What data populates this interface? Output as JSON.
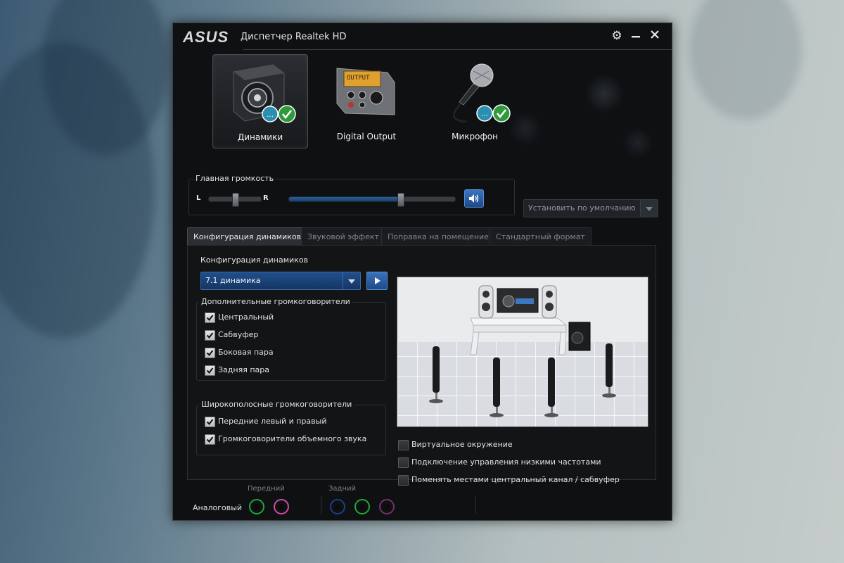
{
  "window": {
    "logo": "ASUS",
    "title": "Диспетчер Realtek HD"
  },
  "titlebar_icons": [
    "gear-icon",
    "minimize-icon",
    "close-icon"
  ],
  "devices": [
    {
      "label": "Динамики",
      "icon": "speaker-icon",
      "active": true,
      "badges": [
        "chat-badge-icon",
        "check-badge-icon"
      ]
    },
    {
      "label": "Digital Output",
      "icon": "digital-output-icon",
      "active": false
    },
    {
      "label": "Микрофон",
      "icon": "microphone-icon",
      "active": false,
      "badges": [
        "chat-badge-icon",
        "check-badge-icon"
      ]
    }
  ],
  "volume": {
    "title": "Главная громкость",
    "left_label": "L",
    "right_label": "R",
    "balance": 0.5,
    "level": 0.67
  },
  "default_button": {
    "label": "Установить по умолчанию"
  },
  "tabs": [
    {
      "label": "Конфигурация динамиков",
      "active": true
    },
    {
      "label": "Звуковой эффект",
      "active": false
    },
    {
      "label": "Поправка на помещение",
      "active": false
    },
    {
      "label": "Стандартный формат",
      "active": false
    }
  ],
  "speaker_config": {
    "label": "Конфигурация динамиков",
    "selected": "7.1 динамика"
  },
  "optional_speakers": {
    "title": "Дополнительные громкоговорители",
    "items": [
      {
        "label": "Центральный",
        "checked": true
      },
      {
        "label": "Сабвуфер",
        "checked": true
      },
      {
        "label": "Боковая пара",
        "checked": true
      },
      {
        "label": "Задняя пара",
        "checked": true
      }
    ]
  },
  "fullrange_speakers": {
    "title": "Широкополосные громкоговорители",
    "items": [
      {
        "label": "Передние левый и правый",
        "checked": true
      },
      {
        "label": "Громкоговорители объемного звука",
        "checked": true
      }
    ]
  },
  "extra_options": [
    {
      "label": "Виртуальное окружение",
      "checked": false
    },
    {
      "label": "Подключение управления низкими частотами",
      "checked": false
    },
    {
      "label": "Поменять местами центральный канал / сабвуфер",
      "checked": false
    }
  ],
  "jacks": {
    "title": "Аналоговый",
    "front_label": "Передний",
    "rear_label": "Задний",
    "colors": {
      "green": "#1fa83a",
      "pink": "#d24aa8",
      "blue": "#1d3f8f",
      "magenta_dim": "#7a2f6a"
    }
  }
}
